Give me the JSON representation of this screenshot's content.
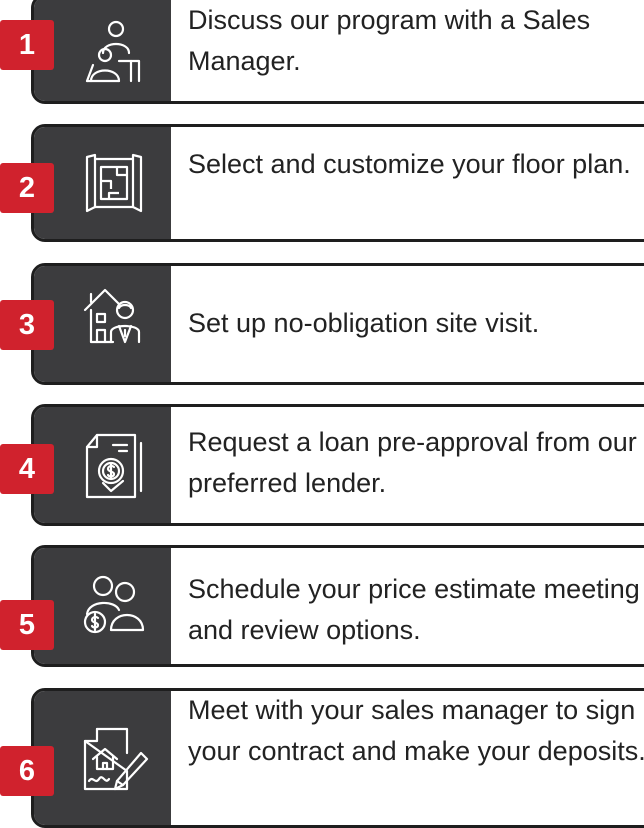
{
  "colors": {
    "accent": "#d0222d",
    "panel": "#3c3c3e",
    "border": "#1e1e1e",
    "text": "#222222"
  },
  "steps": [
    {
      "number": "1",
      "icon": "meeting-person-icon",
      "text": "Discuss our program with a Sales Manager."
    },
    {
      "number": "2",
      "icon": "floor-plan-blueprint-icon",
      "text": "Select and customize your floor plan."
    },
    {
      "number": "3",
      "icon": "house-agent-icon",
      "text": "Set up no-obligation site visit."
    },
    {
      "number": "4",
      "icon": "loan-document-icon",
      "text": "Request a loan pre-approval from our preferred lender."
    },
    {
      "number": "5",
      "icon": "price-estimate-meeting-icon",
      "text": "Schedule your price estimate meeting and review options."
    },
    {
      "number": "6",
      "icon": "contract-signing-icon",
      "text": "Meet with your sales manager to sign your contract and make your deposits."
    }
  ]
}
